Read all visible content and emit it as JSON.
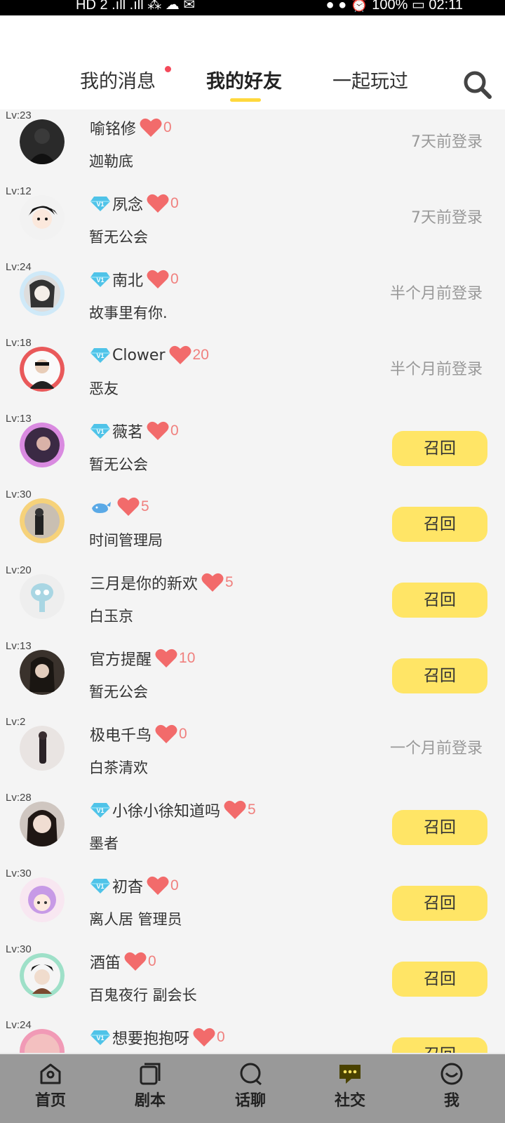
{
  "status_bar": {
    "left": "HD 2 .ıll .ıll ⁂ ☁ ✉",
    "right": "● ● ⏰ 100% ▭ 02:11"
  },
  "tabs": [
    {
      "label": "我的消息",
      "active": false,
      "has_dot": true
    },
    {
      "label": "我的好友",
      "active": true
    },
    {
      "label": "一起玩过",
      "active": false
    }
  ],
  "colors": {
    "accent": "#ffd83d",
    "recall_bg": "#ffe566",
    "heart": "#f26b6b",
    "likes": "#f0807e"
  },
  "recall_label": "召回",
  "friends": [
    {
      "level": "Lv:23",
      "vip": false,
      "nickname": "喻铭修",
      "likes": "0",
      "guild": "迦勒底",
      "status": "7天前登录",
      "recall": false,
      "avatar": "dark-suit"
    },
    {
      "level": "Lv:12",
      "vip": true,
      "nickname": "夙念",
      "likes": "0",
      "guild": "暂无公会",
      "status": "7天前登录",
      "recall": false,
      "avatar": "anime-boy"
    },
    {
      "level": "Lv:24",
      "vip": true,
      "nickname": "南北",
      "likes": "0",
      "guild": "故事里有你.",
      "status": "半个月前登录",
      "recall": false,
      "avatar": "blue-frame-girl"
    },
    {
      "level": "Lv:18",
      "vip": true,
      "nickname": "Clower",
      "likes": "20",
      "guild": "恶友",
      "status": "半个月前登录",
      "recall": false,
      "avatar": "red-frame-boy"
    },
    {
      "level": "Lv:13",
      "vip": true,
      "nickname": "薇茗",
      "likes": "0",
      "guild": "暂无公会",
      "status": "",
      "recall": true,
      "avatar": "purple-frame"
    },
    {
      "level": "Lv:30",
      "vip": false,
      "whale": true,
      "nickname": "",
      "likes": "5",
      "guild": "时间管理局",
      "status": "",
      "recall": true,
      "avatar": "flower-frame"
    },
    {
      "level": "Lv:20",
      "vip": false,
      "nickname": "三月是你的新欢",
      "likes": "5",
      "guild": "白玉京",
      "status": "",
      "recall": true,
      "avatar": "squidward"
    },
    {
      "level": "Lv:13",
      "vip": false,
      "nickname": "官方提醒",
      "likes": "10",
      "guild": "暂无公会",
      "status": "",
      "recall": true,
      "avatar": "dark-girl"
    },
    {
      "level": "Lv:2",
      "vip": false,
      "nickname": "极电千鸟",
      "likes": "0",
      "guild": "白茶清欢",
      "status": "一个月前登录",
      "recall": false,
      "avatar": "mirror-selfie"
    },
    {
      "level": "Lv:28",
      "vip": true,
      "nickname": "小徐小徐知道吗",
      "likes": "5",
      "guild": "墨者",
      "status": "",
      "recall": true,
      "avatar": "girl-portrait"
    },
    {
      "level": "Lv:30",
      "vip": true,
      "nickname": "初杳",
      "likes": "0",
      "guild": "离人居 管理员",
      "status": "",
      "recall": true,
      "avatar": "cartoon-girl"
    },
    {
      "level": "Lv:30",
      "vip": false,
      "nickname": "酒笛",
      "likes": "0",
      "guild": "百鬼夜行 副会长",
      "status": "",
      "recall": true,
      "avatar": "green-frame-boy"
    },
    {
      "level": "Lv:24",
      "vip": true,
      "nickname": "想要抱抱呀",
      "likes": "0",
      "guild": "",
      "status": "",
      "recall": true,
      "avatar": "pink-frame"
    }
  ],
  "bottom_nav": [
    {
      "label": "首页",
      "icon": "home-icon",
      "active": false
    },
    {
      "label": "剧本",
      "icon": "script-icon",
      "active": false
    },
    {
      "label": "话聊",
      "icon": "chat-bubble-icon",
      "active": false
    },
    {
      "label": "社交",
      "icon": "social-message-icon",
      "active": true
    },
    {
      "label": "我",
      "icon": "profile-icon",
      "active": false
    }
  ]
}
